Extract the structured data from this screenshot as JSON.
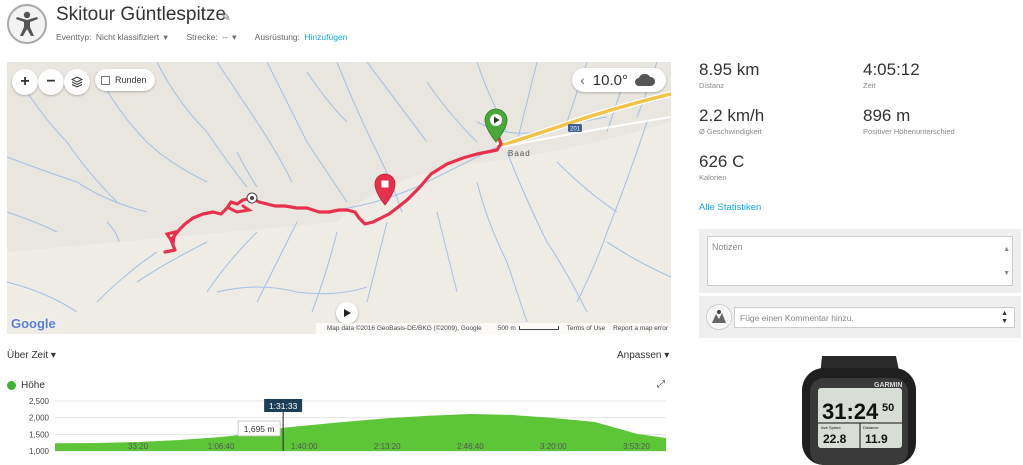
{
  "header": {
    "title": "Skitour Güntlespitze",
    "event_type_label": "Eventtyp:",
    "event_type_value": "Nicht klassifiziert",
    "route_label": "Strecke:",
    "route_value": "--",
    "gear_label": "Ausrüstung:",
    "gear_link": "Hinzufügen"
  },
  "map": {
    "zoom_in": "+",
    "zoom_out": "−",
    "runden_label": "Runden",
    "temperature": "10.0°",
    "place_label": "Baad",
    "road_label": "201",
    "google_label": "Google",
    "attribution": "Map data ©2016 GeoBasis-DE/BKG (©2009), Google",
    "scale_label": "500 m",
    "terms": "Terms of Use",
    "report": "Report a map error"
  },
  "chart_controls": {
    "x_mode": "Über Zeit",
    "customize": "Anpassen"
  },
  "chart_data": {
    "type": "area",
    "series": [
      {
        "name": "Höhe",
        "x": [
          "0:00:00",
          "0:16:40",
          "0:33:20",
          "0:50:00",
          "1:06:40",
          "1:23:20",
          "1:31:33",
          "1:40:00",
          "1:56:40",
          "2:13:20",
          "2:30:00",
          "2:46:40",
          "3:03:20",
          "3:20:00",
          "3:36:40",
          "3:53:20",
          "4:05:12"
        ],
        "values": [
          1230,
          1240,
          1270,
          1330,
          1420,
          1560,
          1695,
          1760,
          1880,
          1980,
          2060,
          2110,
          2080,
          1990,
          1870,
          1520,
          1390
        ]
      }
    ],
    "color": "#5cc638",
    "ylim": [
      1000,
      2500
    ],
    "yticks": [
      "2,500",
      "2,000",
      "1,500",
      "1,000"
    ],
    "ytick_values": [
      2500,
      2000,
      1500,
      1000
    ],
    "xticks": [
      "33:20",
      "1:06:40",
      "1:40:00",
      "2:13:20",
      "2:46:40",
      "3:20:00",
      "3:53:20"
    ],
    "cursor_time": "1:31:33",
    "cursor_value_label": "1,695 m",
    "grid": true
  },
  "stats": {
    "distance_value": "8.95 km",
    "distance_label": "Distanz",
    "time_value": "4:05:12",
    "time_label": "Zeit",
    "speed_value": "2.2 km/h",
    "speed_label": "Ø Geschwindigkeit",
    "elevation_value": "896 m",
    "elevation_label": "Positiver Höhenunterschied",
    "calories_value": "626 C",
    "calories_label": "Kalorien",
    "all_stats_link": "Alle Statistiken"
  },
  "notes": {
    "placeholder": "Notizen",
    "comment_placeholder": "Füge einen Kommentar hinzu."
  },
  "device": {
    "brand": "GARMIN",
    "time": "31:24",
    "time_seconds": "50",
    "left_value": "22.8",
    "right_value": "11.9",
    "left_caption": "Ave Speed",
    "right_caption": "Distance"
  },
  "colors": {
    "accent": "#11a9ed",
    "track": "#e8304e",
    "elevation": "#5cc638",
    "start_pin": "#4ca73b",
    "end_pin": "#e8304e"
  }
}
